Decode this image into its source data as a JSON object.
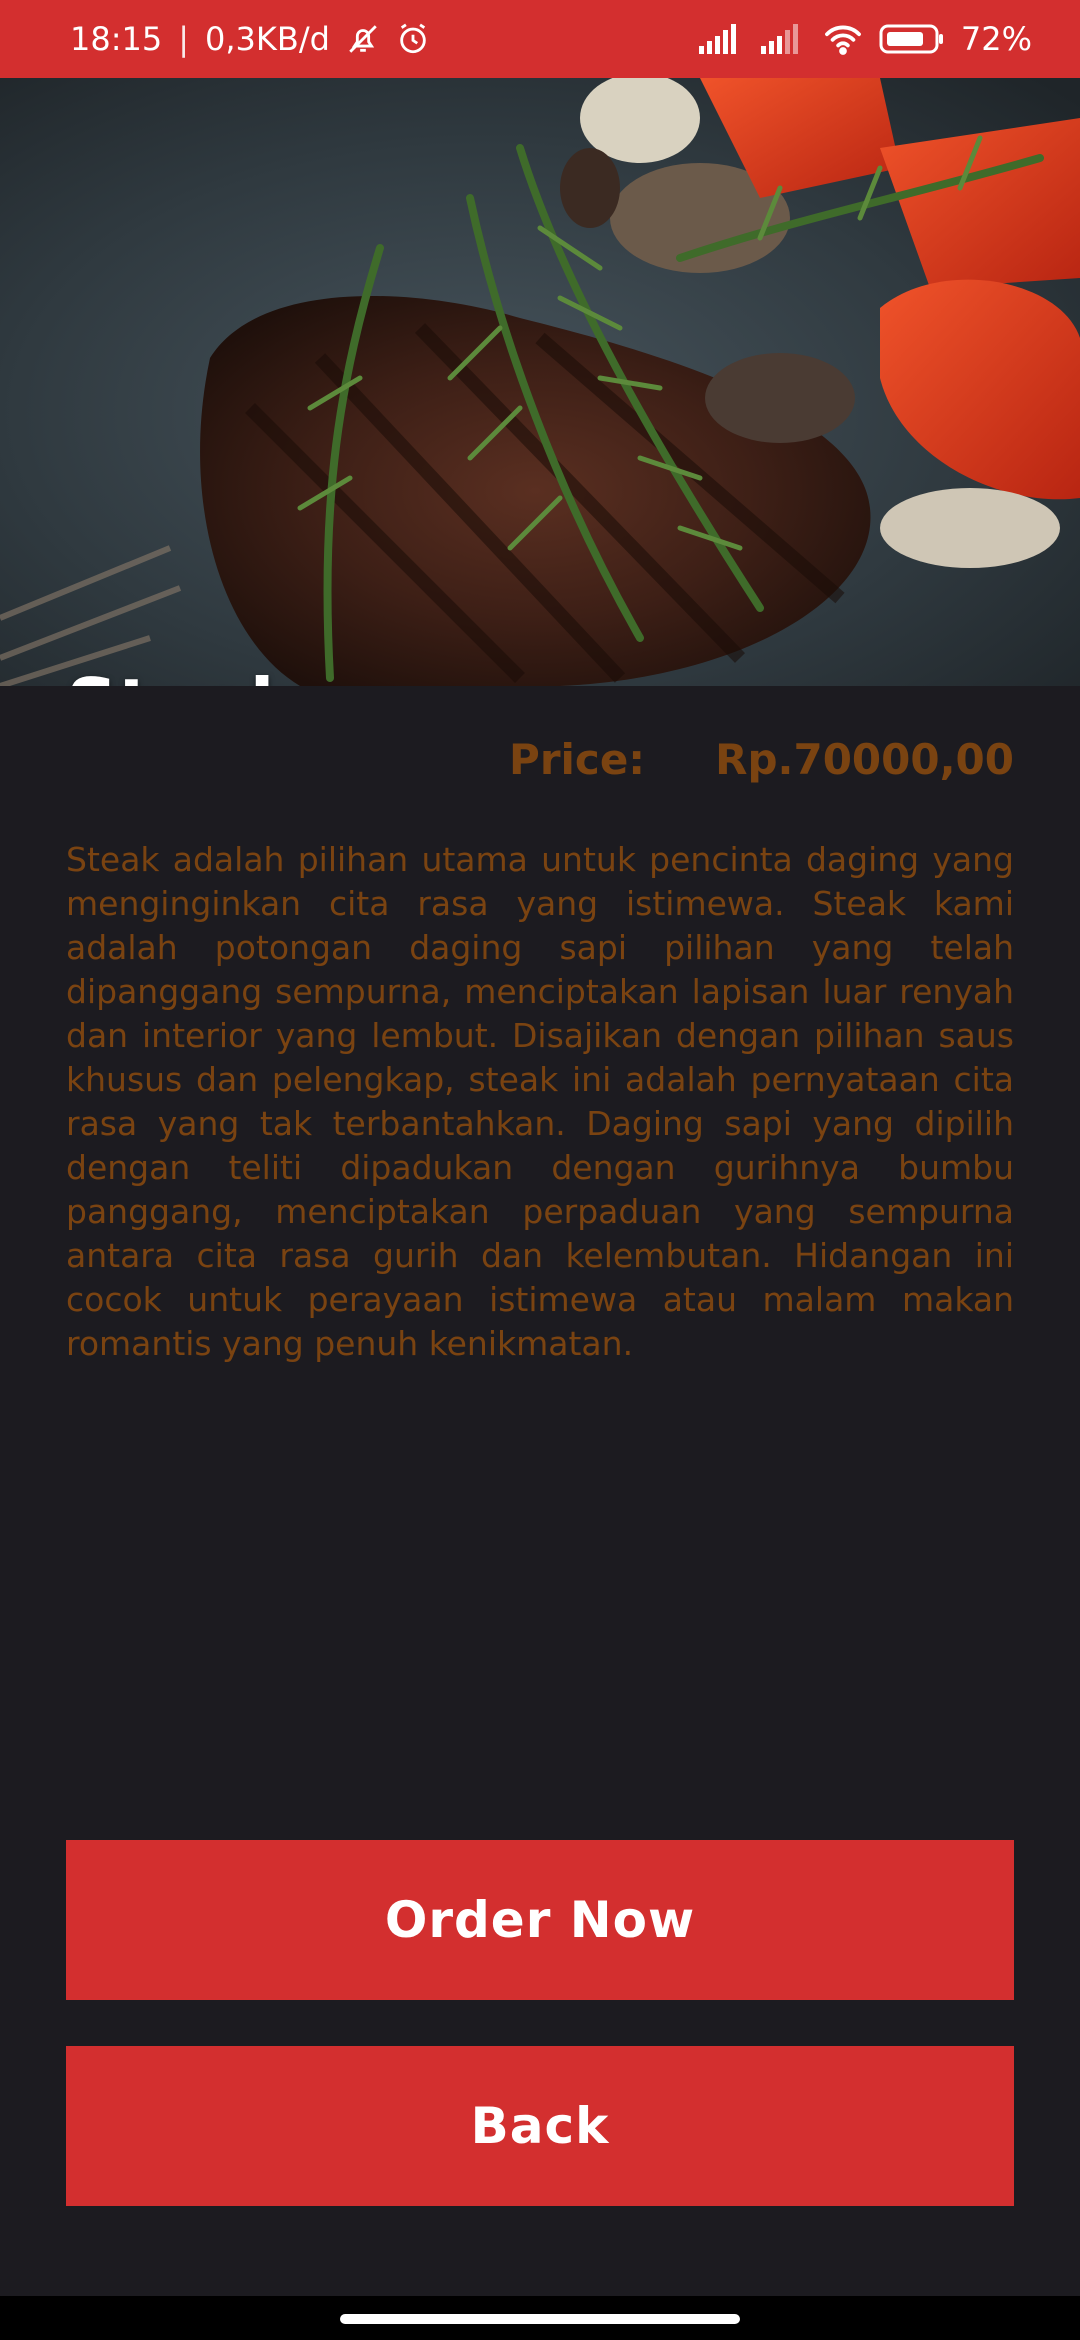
{
  "status_bar": {
    "time": "18:15",
    "separator": "|",
    "network_speed": "0,3KB/d",
    "battery": "72%"
  },
  "hero": {
    "title": "Steak"
  },
  "price": {
    "label": "Price:",
    "value": "Rp.70000,00"
  },
  "description": "Steak adalah pilihan utama untuk pencinta daging yang menginginkan cita rasa yang istimewa. Steak kami adalah potongan daging sapi pilihan yang telah dipanggang sempurna, menciptakan lapisan luar renyah dan interior yang lembut. Disajikan dengan pilihan saus khusus dan pelengkap, steak ini adalah pernyataan cita rasa yang tak terbantahkan. Daging sapi yang dipilih dengan teliti dipadukan dengan gurihnya bumbu panggang, menciptakan perpaduan yang sempurna antara cita rasa gurih dan kelembutan. Hidangan ini cocok untuk perayaan istimewa atau malam makan romantis yang penuh kenikmatan.",
  "buttons": {
    "order": "Order Now",
    "back": "Back"
  },
  "colors": {
    "accent": "#d32f2f",
    "background": "#1c1b20",
    "text_brown": "#7a4311"
  }
}
